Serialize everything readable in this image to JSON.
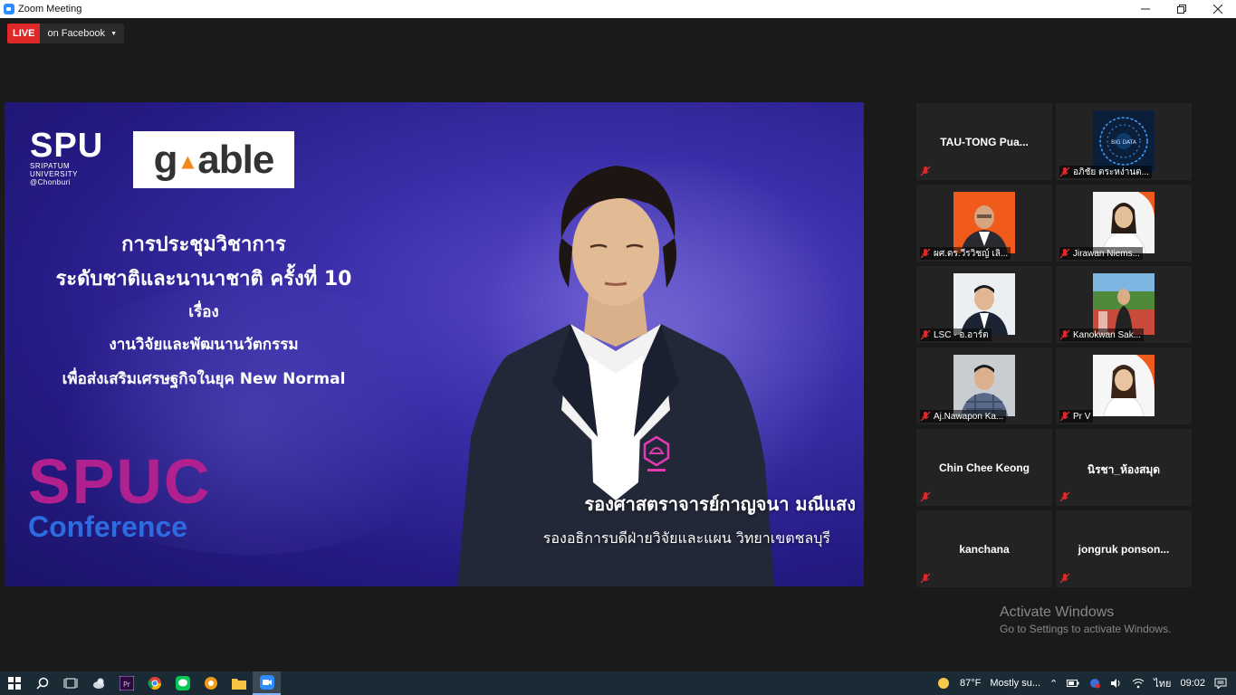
{
  "window": {
    "title": "Zoom Meeting",
    "controls": [
      "minimize",
      "restore",
      "close"
    ]
  },
  "live": {
    "badge": "LIVE",
    "target": "on Facebook"
  },
  "main_video": {
    "spu_logo_big": "SPU",
    "spu_logo_small_1": "SRIPATUM",
    "spu_logo_small_2": "UNIVERSITY",
    "spu_logo_small_3": "@Chonburi",
    "partner_logo_left": "g",
    "partner_logo_right": "able",
    "conference_line1": "การประชุมวิชาการ",
    "conference_line2": "ระดับชาติและนานาชาติ ครั้งที่ 10",
    "conference_line3": "เรื่อง",
    "conference_line4": "งานวิจัยและพัฒนานวัตกรรม",
    "conference_line5": "เพื่อส่งเสริมเศรษฐกิจในยุค New Normal",
    "spuc_title": "SPUC",
    "spuc_subtitle": "Conference",
    "speaker_name": "รองศาสตราจารย์กาญจนา มณีแสง",
    "speaker_role": "รองอธิการบดีฝ่ายวิจัยและแผน วิทยาเขตชลบุรี"
  },
  "participants": [
    {
      "name": "TAU-TONG  Pua...",
      "video": false
    },
    {
      "name": "อภิชัย ตระหง่านต...",
      "video": true,
      "thumb": "big-data"
    },
    {
      "name": "ผศ.ดร.วีรวิชญ์ เลิ...",
      "video": true,
      "thumb": "man-orange"
    },
    {
      "name": "Jirawan Niems...",
      "video": true,
      "thumb": "woman-white"
    },
    {
      "name": "LSC - อ.อาร์ต",
      "video": true,
      "thumb": "man-suit"
    },
    {
      "name": "Kanokwan Sak...",
      "video": true,
      "thumb": "woman-outdoor"
    },
    {
      "name": "Aj.Nawapon Ka...",
      "video": true,
      "thumb": "man-plaid"
    },
    {
      "name": "Pr V",
      "video": true,
      "thumb": "woman-red"
    },
    {
      "name": "Chin Chee Keong",
      "video": false
    },
    {
      "name": "นิรชา_ห้องสมุด",
      "video": false
    },
    {
      "name": "kanchana",
      "video": false
    },
    {
      "name": "jongruk  ponson...",
      "video": false
    }
  ],
  "watermark": {
    "title": "Activate Windows",
    "subtitle": "Go to Settings to activate Windows."
  },
  "taskbar": {
    "weather_temp": "87°F",
    "weather_text": "Mostly su...",
    "language": "ไทย",
    "time": "09:02"
  },
  "colors": {
    "live_red": "#e02828",
    "muted_red": "#e02828",
    "zoom_blue": "#2D8CFF"
  }
}
